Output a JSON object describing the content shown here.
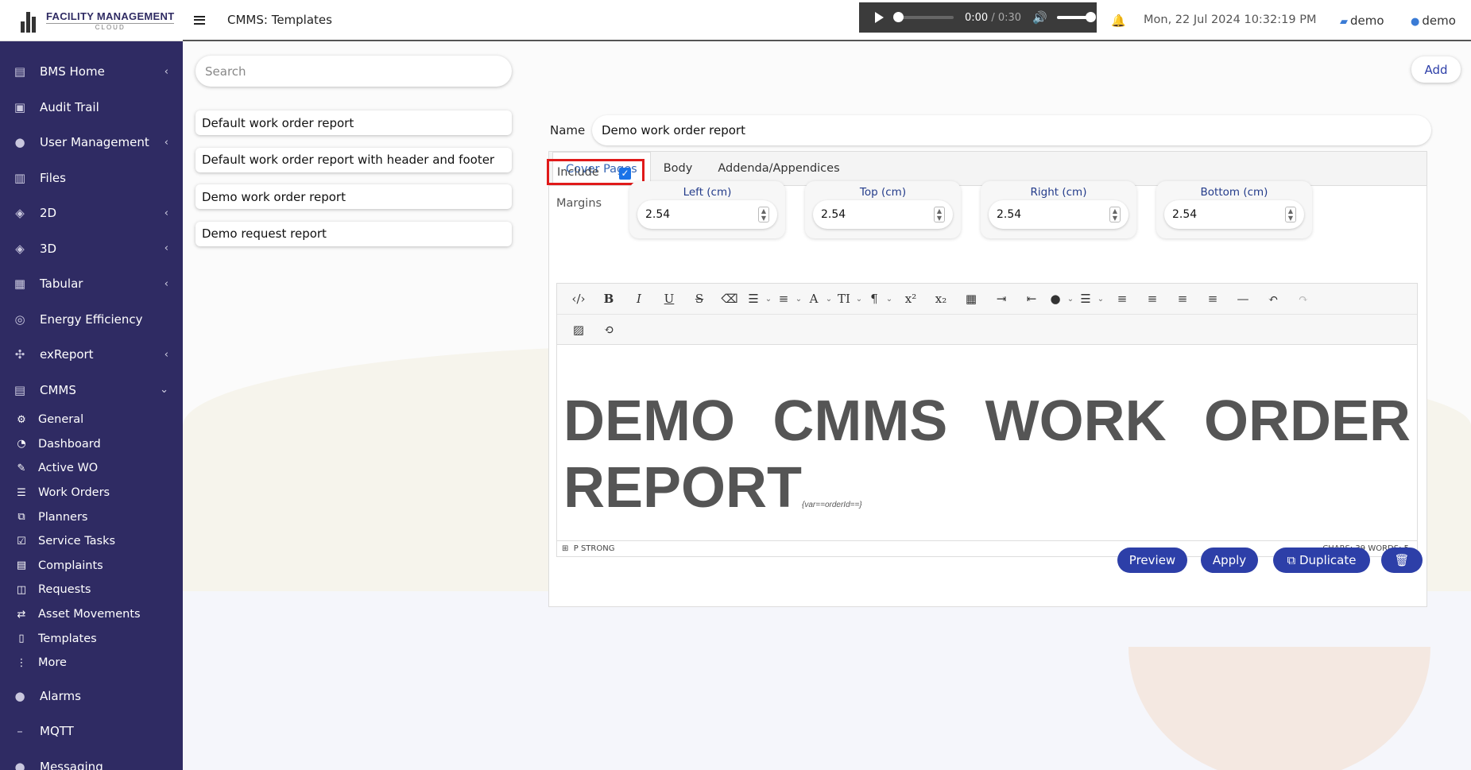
{
  "brand": {
    "name": "FACILITY MANAGEMENT",
    "sub": "CLOUD"
  },
  "sidebar": {
    "items": [
      {
        "label": "BMS Home",
        "icon": "building-icon",
        "chevron": "‹"
      },
      {
        "label": "Audit Trail",
        "icon": "audit-icon",
        "chevron": ""
      },
      {
        "label": "User Management",
        "icon": "users-icon",
        "chevron": "‹"
      },
      {
        "label": "Files",
        "icon": "files-icon",
        "chevron": ""
      },
      {
        "label": "2D",
        "icon": "layers-icon",
        "chevron": "‹"
      },
      {
        "label": "3D",
        "icon": "layers-3d-icon",
        "chevron": "‹"
      },
      {
        "label": "Tabular",
        "icon": "table-icon",
        "chevron": "‹"
      },
      {
        "label": "Energy Efficiency",
        "icon": "energy-icon",
        "chevron": ""
      },
      {
        "label": "exReport",
        "icon": "report-icon",
        "chevron": "‹"
      },
      {
        "label": "CMMS",
        "icon": "cmms-icon",
        "chevron": "⌄"
      }
    ],
    "cmms_sub": [
      {
        "label": "General",
        "icon": "cogs-icon"
      },
      {
        "label": "Dashboard",
        "icon": "dashboard-icon"
      },
      {
        "label": "Active WO",
        "icon": "wrench-icon"
      },
      {
        "label": "Work Orders",
        "icon": "list-icon"
      },
      {
        "label": "Planners",
        "icon": "planner-icon"
      },
      {
        "label": "Service Tasks",
        "icon": "check-square-icon"
      },
      {
        "label": "Complaints",
        "icon": "complaint-icon"
      },
      {
        "label": "Requests",
        "icon": "requests-icon"
      },
      {
        "label": "Asset Movements",
        "icon": "exchange-icon"
      },
      {
        "label": "Templates",
        "icon": "template-icon"
      },
      {
        "label": "More",
        "icon": "more-icon"
      }
    ],
    "bottom": [
      {
        "label": "Alarms",
        "icon": "alarm-icon"
      },
      {
        "label": "MQTT",
        "icon": "mqtt-icon"
      },
      {
        "label": "Messaging",
        "icon": "messaging-icon"
      }
    ]
  },
  "header": {
    "title": "CMMS: Templates",
    "audio": {
      "current": "0:00",
      "duration": "/ 0:30"
    },
    "datetime": "Mon, 22 Jul 2024 10:32:19 PM",
    "user_a": "demo",
    "user_b": "demo"
  },
  "search": {
    "placeholder": "Search"
  },
  "add_label": "Add",
  "templates": [
    "Default work order report",
    "Default work order report with header and footer",
    "Demo work order report",
    "Demo request report"
  ],
  "form": {
    "name_label": "Name",
    "name_value": "Demo work order report",
    "tabs": [
      "Cover Pages",
      "Body",
      "Addenda/Appendices"
    ],
    "include_label": "Include",
    "margins_label": "Margins",
    "margins": [
      {
        "label": "Left (cm)",
        "value": "2.54"
      },
      {
        "label": "Top (cm)",
        "value": "2.54"
      },
      {
        "label": "Right (cm)",
        "value": "2.54"
      },
      {
        "label": "Bottom (cm)",
        "value": "2.54"
      }
    ]
  },
  "editor": {
    "headline": "DEMO CMMS WORK ORDER REPORT",
    "var": "{var==orderId==}",
    "path": "P   STRONG",
    "counts": "CHARS: 39   WORDS: 5"
  },
  "actions": {
    "preview": "Preview",
    "apply": "Apply",
    "duplicate": "Duplicate"
  },
  "colors": {
    "sidebar": "#2f2b63",
    "accent": "#2d3fa8",
    "highlight": "#e01a1a"
  }
}
